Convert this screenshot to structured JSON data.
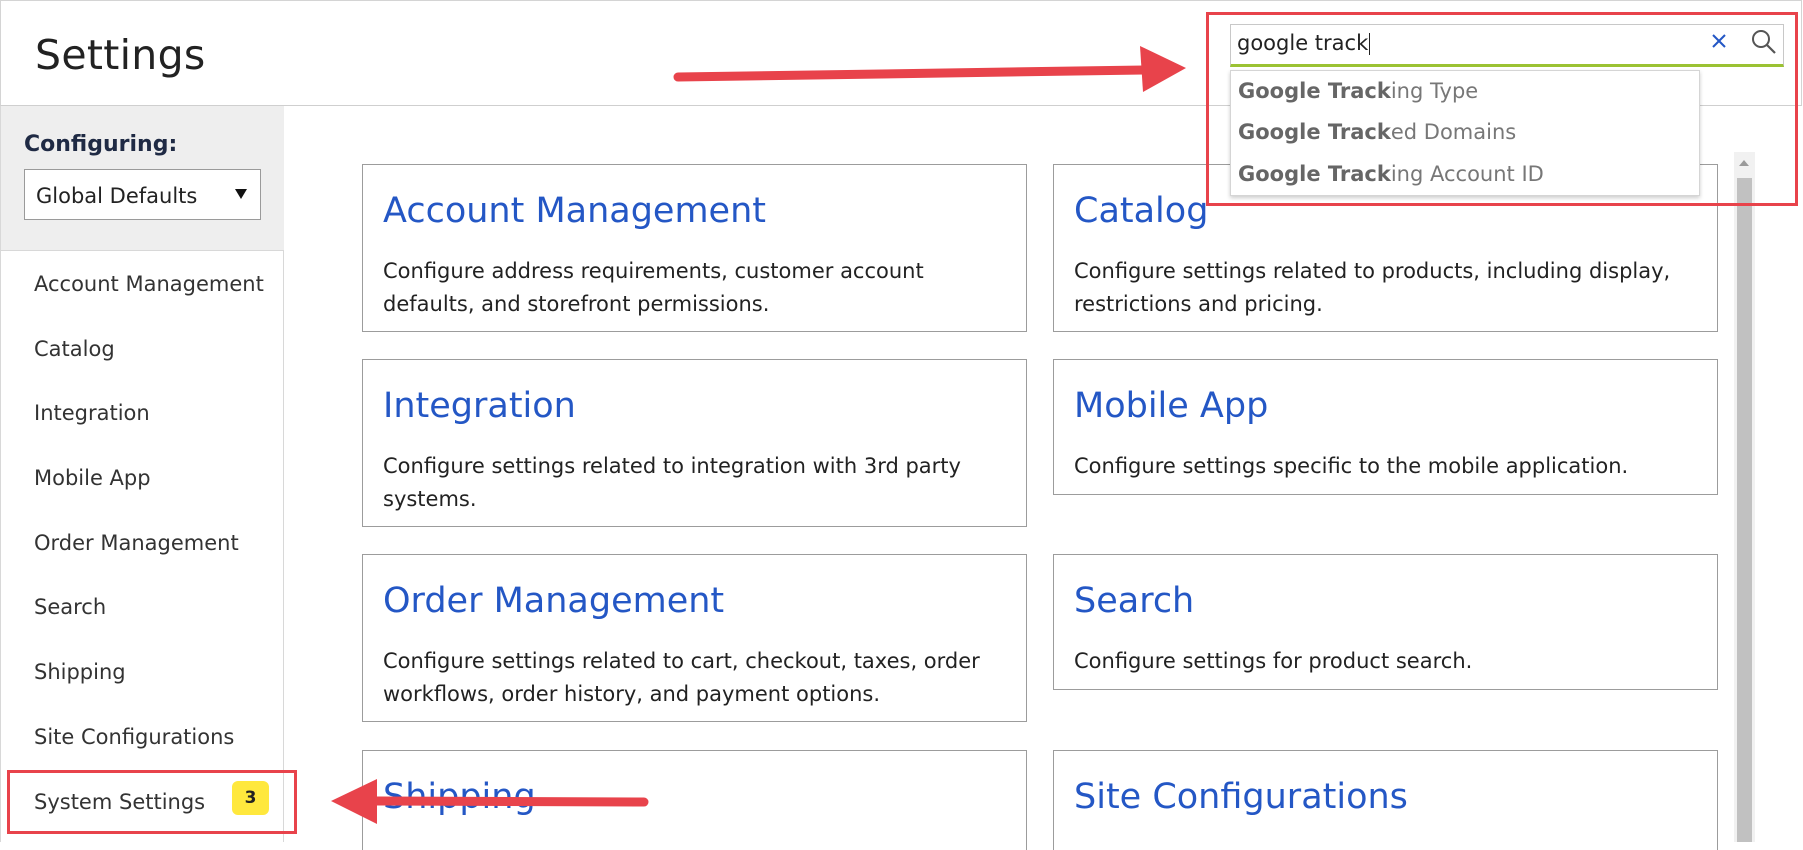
{
  "header": {
    "title": "Settings"
  },
  "search": {
    "value": "google track",
    "suggestions": [
      {
        "match": "Google Track",
        "rest": "ing Type"
      },
      {
        "match": "Google Track",
        "rest": "ed Domains"
      },
      {
        "match": "Google Track",
        "rest": "ing Account ID"
      }
    ]
  },
  "sidebar": {
    "configuring_label": "Configuring:",
    "scope_value": "Global Defaults",
    "items": [
      {
        "label": "Account Management"
      },
      {
        "label": "Catalog"
      },
      {
        "label": "Integration"
      },
      {
        "label": "Mobile App"
      },
      {
        "label": "Order Management"
      },
      {
        "label": "Search"
      },
      {
        "label": "Shipping"
      },
      {
        "label": "Site Configurations"
      },
      {
        "label": "System Settings",
        "badge": "3"
      }
    ]
  },
  "cards": [
    {
      "title": "Account Management",
      "description": "Configure address requirements, customer account defaults, and storefront permissions."
    },
    {
      "title": "Catalog",
      "description": "Configure settings related to products, including display, restrictions and pricing."
    },
    {
      "title": "Integration",
      "description": "Configure settings related to integration with 3rd party systems."
    },
    {
      "title": "Mobile App",
      "description": "Configure settings specific to the mobile application."
    },
    {
      "title": "Order Management",
      "description": "Configure settings related to cart, checkout, taxes, order workflows, order history, and payment options."
    },
    {
      "title": "Search",
      "description": "Configure settings for product search."
    },
    {
      "title": "Shipping",
      "description": ""
    },
    {
      "title": "Site Configurations",
      "description": ""
    }
  ],
  "colors": {
    "accent_link": "#2457c5",
    "badge": "#ffe83d",
    "annotation": "#e8434b",
    "search_underline": "#9bc233"
  }
}
